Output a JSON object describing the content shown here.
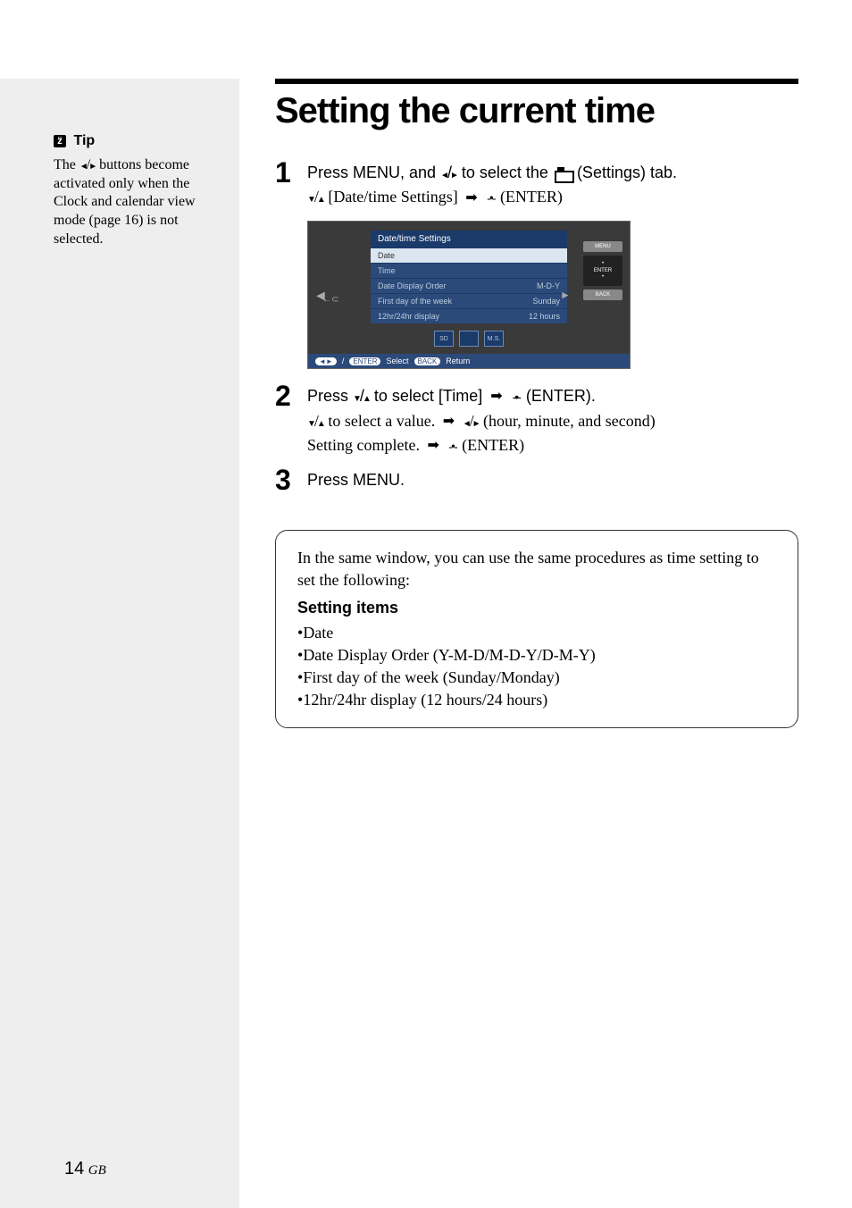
{
  "sidebar": {
    "tip_label": "Tip",
    "tip_text_1": "The ",
    "tip_text_2": " buttons become activated only when the Clock and calendar view mode (page 16) is not selected."
  },
  "title": "Setting the current time",
  "step1": {
    "num": "1",
    "line1_a": "Press MENU, and ",
    "line1_b": " to select the ",
    "line1_c": " (Settings) tab.",
    "line2_a": " [Date/time Settings] ",
    "line2_b": " (ENTER)"
  },
  "screenshot": {
    "header": "Date/time Settings",
    "rows": [
      {
        "label": "Date",
        "value": ""
      },
      {
        "label": "Time",
        "value": ""
      },
      {
        "label": "Date Display Order",
        "value": "M-D-Y"
      },
      {
        "label": "First day of the week",
        "value": "Sunday"
      },
      {
        "label": "12hr/24hr display",
        "value": "12 hours"
      }
    ],
    "side_buttons": [
      "MENU",
      "ENTER",
      "BACK"
    ],
    "bottom_icons": [
      "SD",
      "",
      "M.S."
    ],
    "footer_select": "Select",
    "footer_return": "Return",
    "footer_enter": "ENTER",
    "footer_back": "BACK"
  },
  "step2": {
    "num": "2",
    "line1_a": "Press ",
    "line1_b": " to select [Time] ",
    "line1_c": " (ENTER).",
    "line2_a": " to select a value. ",
    "line2_b": " (hour, minute, and second)",
    "line3_a": "Setting complete. ",
    "line3_b": " (ENTER)"
  },
  "step3": {
    "num": "3",
    "line1": "Press MENU."
  },
  "info_box": {
    "intro": "In the same window, you can use the same procedures as time setting to set the following:",
    "heading": "Setting items",
    "items": [
      "Date",
      "Date Display Order (Y-M-D/M-D-Y/D-M-Y)",
      "First day of the week (Sunday/Monday)",
      "12hr/24hr display (12 hours/24 hours)"
    ]
  },
  "page": {
    "num": "14",
    "region": "GB"
  }
}
